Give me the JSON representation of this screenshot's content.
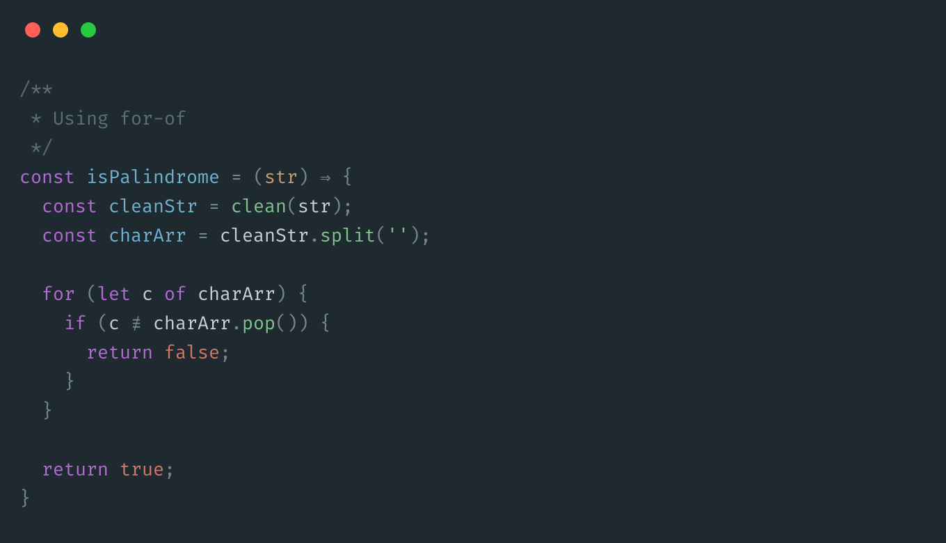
{
  "colors": {
    "bg": "#1e2a30",
    "red": "#ff5f56",
    "yellow": "#ffbd2e",
    "green": "#27c93f"
  },
  "code": {
    "comment_open": "/**",
    "comment_body": " * Using for-of",
    "comment_close": " */",
    "l1": {
      "const": "const",
      "name": "isPalindrome",
      "eq": " = ",
      "lp": "(",
      "param": "str",
      "rp": ")",
      "arrow": " ⇒ ",
      "lbrace": "{"
    },
    "l2": {
      "indent": "  ",
      "const": "const",
      "name": "cleanStr",
      "eq": " = ",
      "fn": "clean",
      "lp": "(",
      "arg": "str",
      "rp": ")",
      "semi": ";"
    },
    "l3": {
      "indent": "  ",
      "const": "const",
      "name": "charArr",
      "eq": " = ",
      "obj": "cleanStr",
      "dot": ".",
      "method": "split",
      "lp": "(",
      "arg": "''",
      "rp": ")",
      "semi": ";"
    },
    "blank1": "",
    "l4": {
      "indent": "  ",
      "for": "for",
      "sp": " ",
      "lp": "(",
      "let": "let",
      "var": " c ",
      "of": "of",
      "iter": " charArr",
      "rp": ")",
      "lbrace": " {"
    },
    "l5": {
      "indent": "    ",
      "if": "if",
      "sp": " ",
      "lp": "(",
      "lhs": "c ",
      "neq": "≢",
      "rhs_obj": " charArr",
      "dot": ".",
      "method": "pop",
      "lp2": "(",
      "rp2": ")",
      "rp": ")",
      "lbrace": " {"
    },
    "l6": {
      "indent": "      ",
      "return": "return",
      "sp": " ",
      "val": "false",
      "semi": ";"
    },
    "l7": {
      "indent": "    ",
      "rbrace": "}"
    },
    "l8": {
      "indent": "  ",
      "rbrace": "}"
    },
    "blank2": "",
    "l9": {
      "indent": "  ",
      "return": "return",
      "sp": " ",
      "val": "true",
      "semi": ";"
    },
    "l10": {
      "rbrace": "}"
    }
  }
}
